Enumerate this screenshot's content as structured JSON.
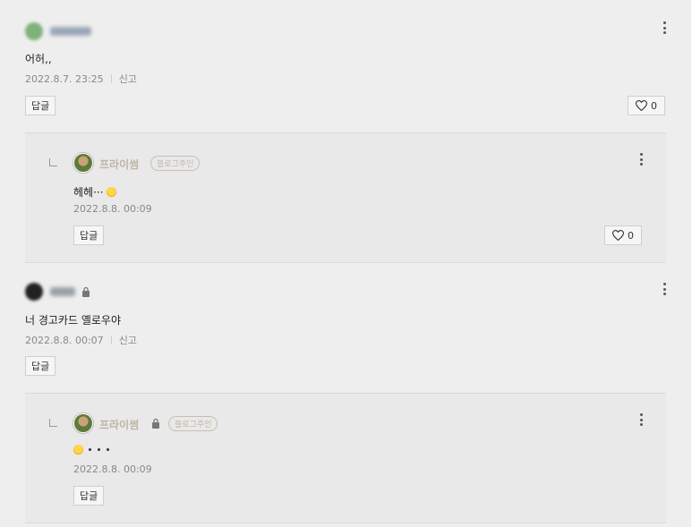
{
  "comments": [
    {
      "text": "어허,,",
      "date": "2022.8.7. 23:25",
      "report_label": "신고",
      "reply_label": "답글",
      "likes": "0",
      "avatar_color": "#7fb27a",
      "name_blur_color": "#9aa8b6",
      "locked": false,
      "reply": {
        "name": "프라이썸",
        "badge": "블로그주인",
        "text": "헤헤···",
        "date": "2022.8.8. 00:09",
        "reply_label": "답글",
        "likes": "0",
        "locked": false,
        "emoji": "grinning-sweat-icon"
      }
    },
    {
      "text": "너 경고카드 옐로우야",
      "date": "2022.8.8. 00:07",
      "report_label": "신고",
      "reply_label": "답글",
      "avatar_color": "#222222",
      "name_blur_color": "#9aa0a6",
      "locked": true,
      "reply": {
        "name": "프라이썸",
        "badge": "블로그주인",
        "text": "",
        "date": "2022.8.8. 00:09",
        "reply_label": "답글",
        "locked": true,
        "emoji": "nerd-face-icon"
      }
    }
  ],
  "colors": {
    "background": "#eeeeee",
    "reply_background": "#e9e9e9",
    "owner_name": "#bdb6a6",
    "meta_text": "#888888"
  }
}
